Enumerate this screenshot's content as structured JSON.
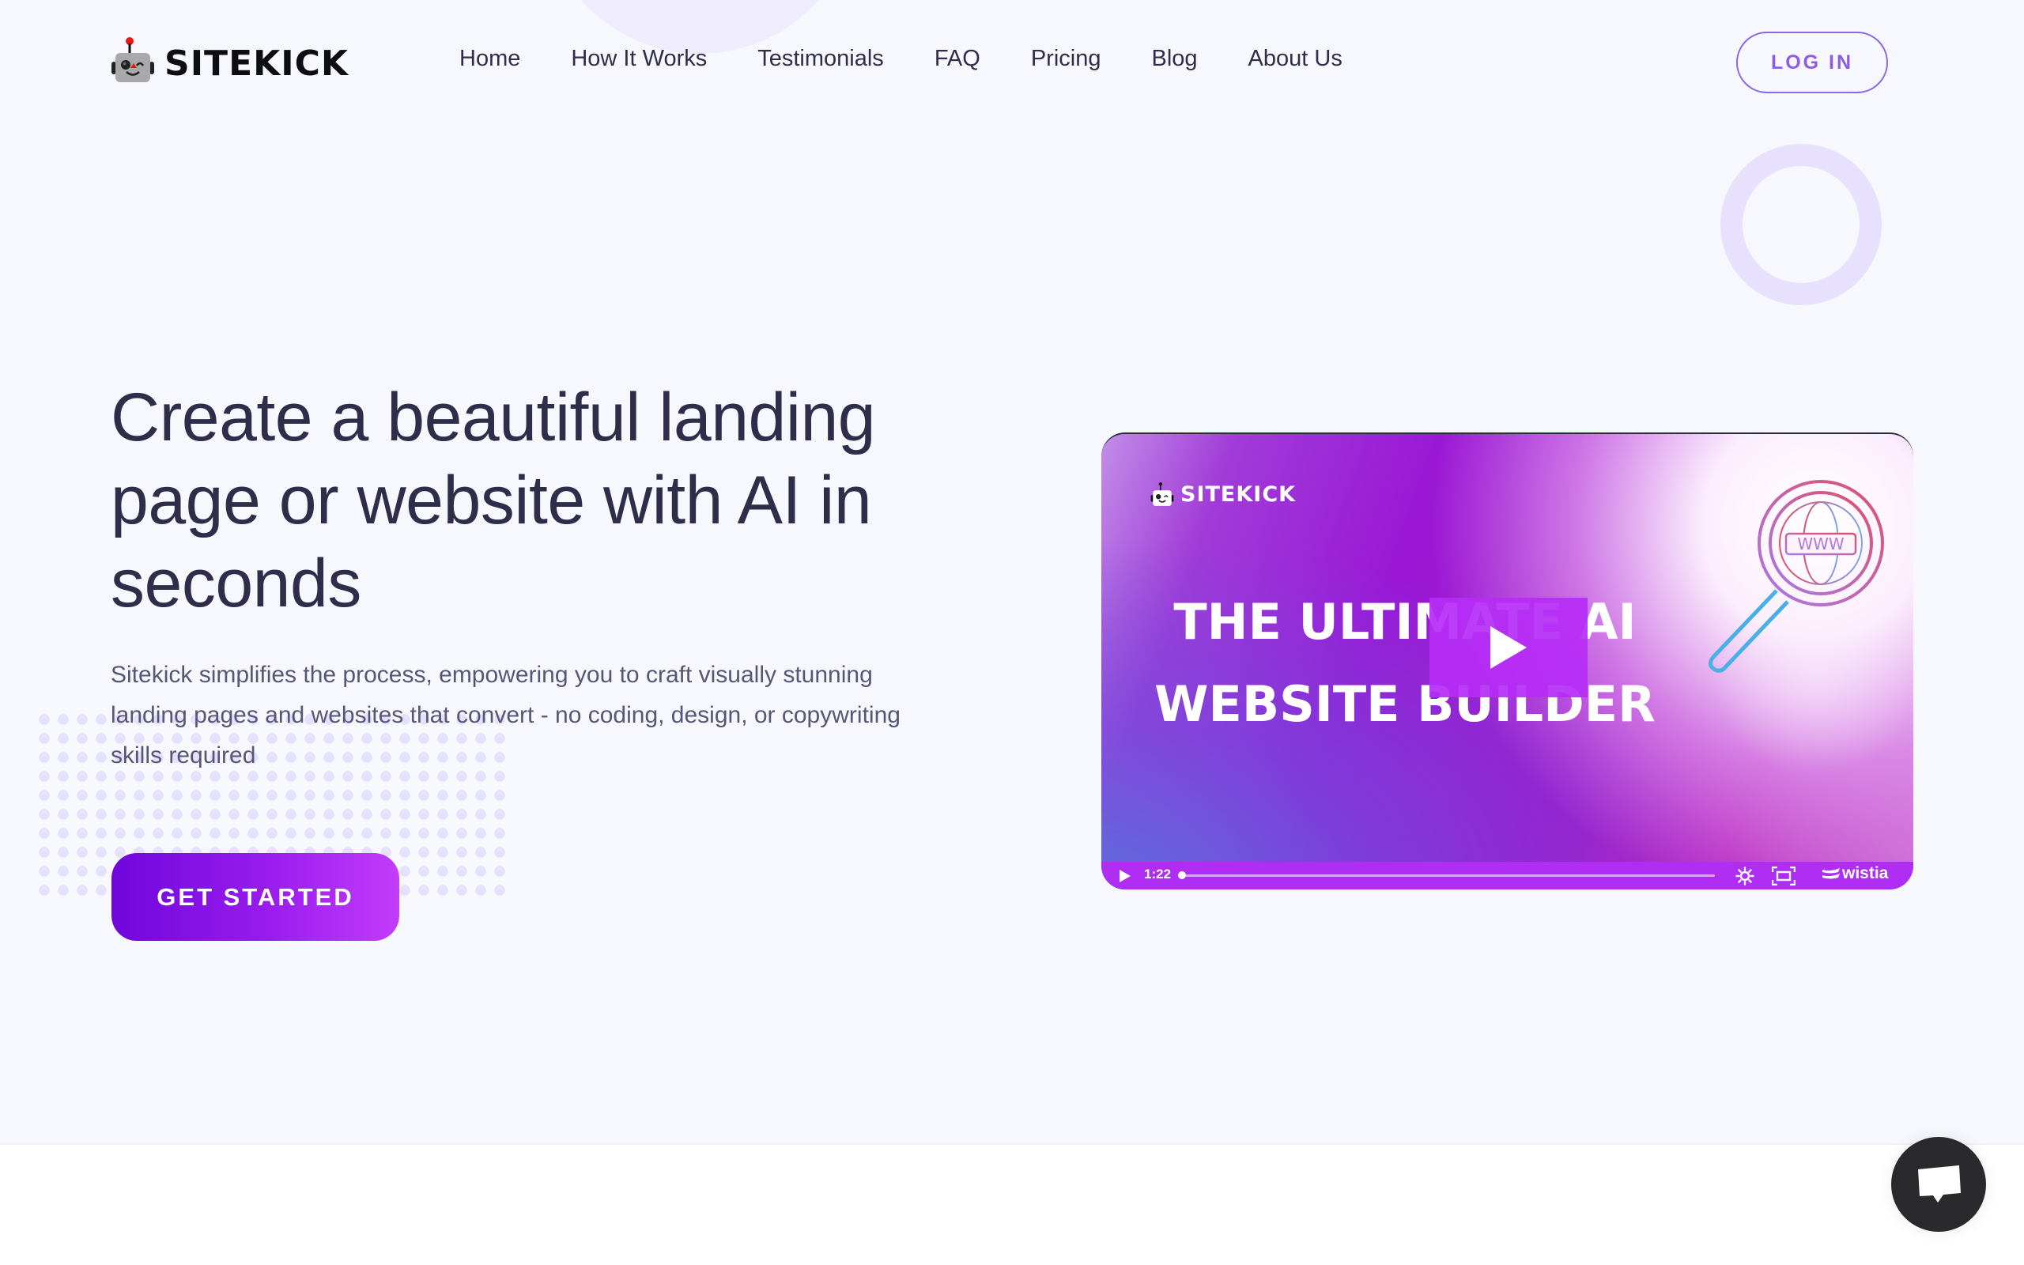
{
  "brand": {
    "name": "SITEKICK",
    "logo_icon": "robot-icon"
  },
  "nav": {
    "items": [
      {
        "label": "Home"
      },
      {
        "label": "How It Works"
      },
      {
        "label": "Testimonials"
      },
      {
        "label": "FAQ"
      },
      {
        "label": "Pricing"
      },
      {
        "label": "Blog"
      },
      {
        "label": "About Us"
      }
    ],
    "login_label": "LOG IN"
  },
  "hero": {
    "headline": "Create a beautiful landing page or website with AI in seconds",
    "subtext": "Sitekick simplifies the process, empowering you to craft visually stunning landing pages and websites that convert - no coding, design, or copywriting skills required",
    "cta_label": "GET STARTED"
  },
  "video": {
    "logo_text": "SITEKICK",
    "title": "THE ULTIMATE AI WEBSITE BUILDER",
    "illustration": "magnifier-www-icon",
    "illustration_text": "WWW",
    "duration": "1:22",
    "progress": 0,
    "provider": "wistia"
  },
  "chat": {
    "icon": "chat-bubble-icon"
  },
  "colors": {
    "background": "#f7f8fd",
    "heading": "#2e2e4a",
    "body_text": "#565675",
    "accent": "#8c5ce8",
    "cta_start": "#6f06dc",
    "cta_end": "#c23cfb",
    "video_bar": "#b02ef4",
    "chat_button": "#2a2a2c"
  }
}
